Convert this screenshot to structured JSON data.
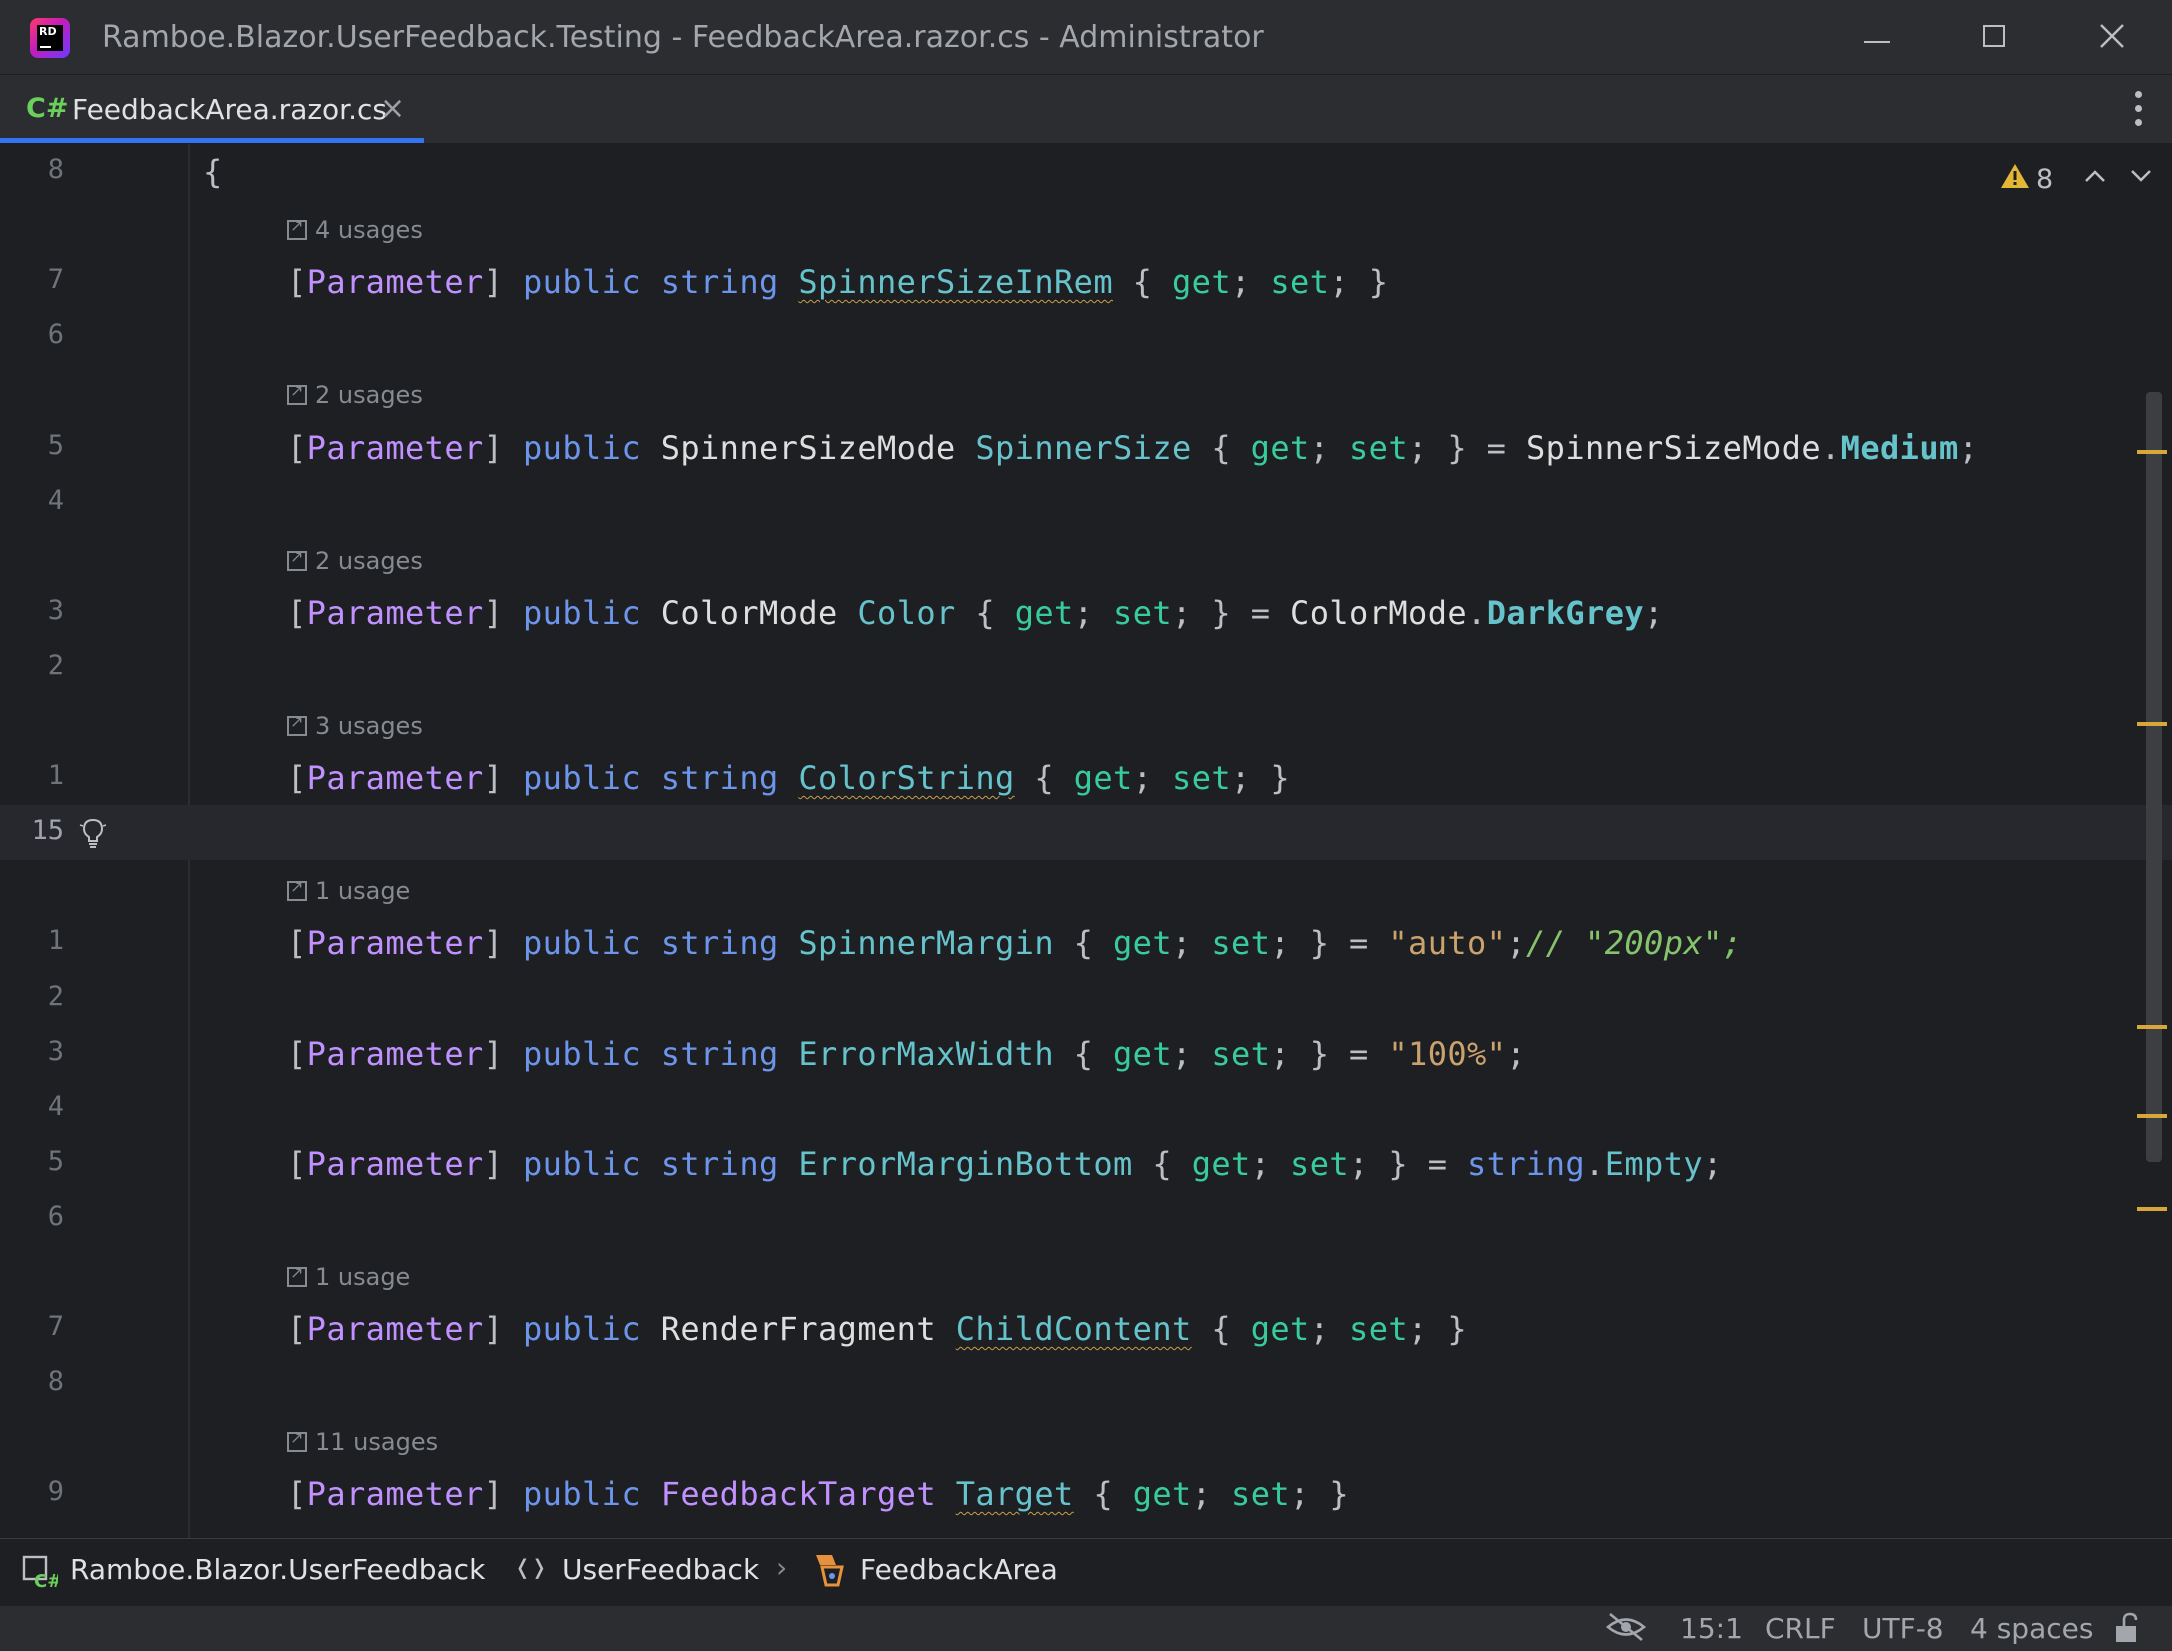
{
  "window": {
    "title": "Ramboe.Blazor.UserFeedback.Testing - FeedbackArea.razor.cs - Administrator",
    "app_icon": "rider-logo-icon",
    "logo_text": "RD"
  },
  "tab": {
    "lang_badge": "C#",
    "label": "FeedbackArea.razor.cs",
    "close_glyph": "×"
  },
  "inspections": {
    "warning_count": "8"
  },
  "lines": [
    {
      "ln": "8",
      "code": "{"
    },
    {
      "hint": "4 usages"
    },
    {
      "ln": "7",
      "kind": "prop",
      "type": "string",
      "type_kind": "kw",
      "name": "SpinnerSizeInRem",
      "wavy": true,
      "tail": ""
    },
    {
      "ln": "6"
    },
    {
      "hint": "2 usages"
    },
    {
      "ln": "5",
      "kind": "prop",
      "type": "SpinnerSizeMode",
      "type_kind": "cls",
      "name": "SpinnerSize",
      "wavy": false,
      "init_type": "SpinnerSizeMode",
      "init_member": "Medium"
    },
    {
      "ln": "4"
    },
    {
      "hint": "2 usages"
    },
    {
      "ln": "3",
      "kind": "prop",
      "type": "ColorMode",
      "type_kind": "cls",
      "name": "Color",
      "wavy": false,
      "init_type": "ColorMode",
      "init_member": "DarkGrey"
    },
    {
      "ln": "2"
    },
    {
      "hint": "3 usages"
    },
    {
      "ln": "1",
      "kind": "prop",
      "type": "string",
      "type_kind": "kw",
      "name": "ColorString",
      "wavy": true
    },
    {
      "ln": "15",
      "current": true
    },
    {
      "hint": "1 usage"
    },
    {
      "ln": "1",
      "kind": "prop",
      "type": "string",
      "type_kind": "kw",
      "name": "SpinnerMargin",
      "wavy": false,
      "init_str": "\"auto\"",
      "comment": "// \"200px\";"
    },
    {
      "ln": "2"
    },
    {
      "ln": "3",
      "kind": "prop",
      "type": "string",
      "type_kind": "kw",
      "name": "ErrorMaxWidth",
      "wavy": false,
      "init_str": "\"100%\""
    },
    {
      "ln": "4"
    },
    {
      "ln": "5",
      "kind": "prop",
      "type": "string",
      "type_kind": "kw",
      "name": "ErrorMarginBottom",
      "wavy": false,
      "init_kw": "string",
      "init_prop": "Empty"
    },
    {
      "ln": "6"
    },
    {
      "hint": "1 usage"
    },
    {
      "ln": "7",
      "kind": "prop",
      "type": "RenderFragment",
      "type_kind": "cls",
      "name": "ChildContent",
      "wavy": true
    },
    {
      "ln": "8"
    },
    {
      "hint": "11 usages"
    },
    {
      "ln": "9",
      "kind": "prop",
      "type": "FeedbackTarget",
      "type_kind": "attr",
      "name": "Target",
      "wavy": true
    }
  ],
  "tokens": {
    "attr_open": "[",
    "attr_name": "Parameter",
    "attr_close": "]",
    "public": "public",
    "get": "get",
    "set": "set"
  },
  "breadcrumb": {
    "project": "Ramboe.Blazor.UserFeedback",
    "namespace_glyph": "❬❭",
    "namespace": "UserFeedback",
    "separator": "›",
    "class": "FeedbackArea"
  },
  "status": {
    "caret": "15:1",
    "line_endings": "CRLF",
    "encoding": "UTF-8",
    "indent": "4 spaces"
  },
  "colors": {
    "background": "#1e1f22",
    "chrome": "#2b2d30",
    "accent": "#3574f0",
    "keyword": "#6c95eb",
    "attribute": "#c191ff",
    "property": "#66c3cc",
    "accessor": "#39cc9b",
    "string": "#c9a26d",
    "comment": "#85c46c",
    "warning": "#e2b736"
  }
}
